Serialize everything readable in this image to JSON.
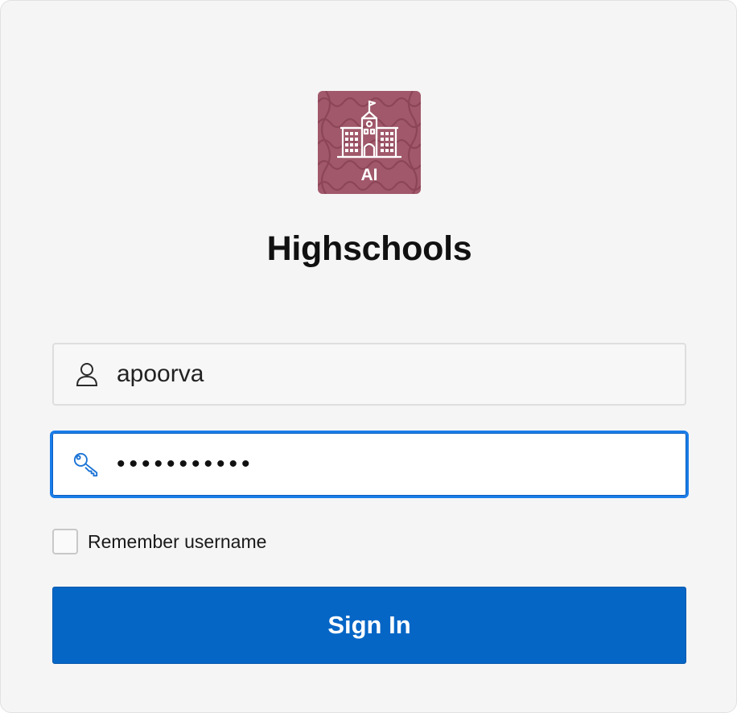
{
  "app": {
    "title": "Highschools",
    "logo_text": "AI",
    "logo_icon": "school-building-icon"
  },
  "form": {
    "username": {
      "icon": "user-icon",
      "value": "apoorva"
    },
    "password": {
      "icon": "key-icon",
      "masked_value": "•••••••••••"
    },
    "remember_label": "Remember username",
    "remember_checked": false,
    "submit_label": "Sign In"
  },
  "colors": {
    "logo_bg": "#a0586a",
    "primary": "#0666c6",
    "focus_border": "#1a7ce8",
    "card_bg": "#f5f5f5"
  }
}
